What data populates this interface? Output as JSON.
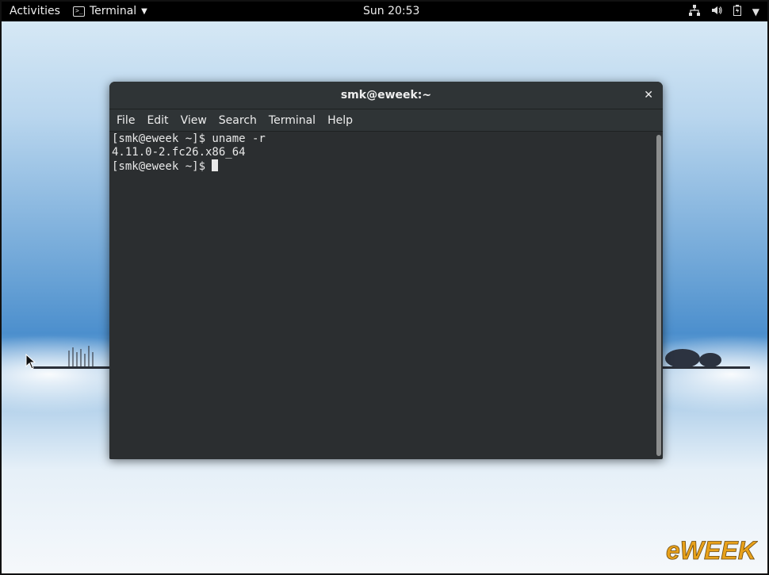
{
  "topbar": {
    "activities": "Activities",
    "app_menu_label": "Terminal",
    "clock": "Sun 20:53",
    "tray_icons": [
      "network-icon",
      "volume-icon",
      "battery-icon",
      "system-menu-icon"
    ]
  },
  "terminal": {
    "title": "smk@eweek:~",
    "menu": [
      "File",
      "Edit",
      "View",
      "Search",
      "Terminal",
      "Help"
    ],
    "lines": [
      "[smk@eweek ~]$ uname -r",
      "4.11.0-2.fc26.x86_64",
      "[smk@eweek ~]$ "
    ],
    "close_icon": "close-icon"
  },
  "watermark": {
    "text": "eWEEK"
  },
  "colors": {
    "topbar_bg": "#000000",
    "terminal_bg": "#2b2e30",
    "titlebar_bg": "#2f3436",
    "watermark_color": "#e8a11a"
  }
}
